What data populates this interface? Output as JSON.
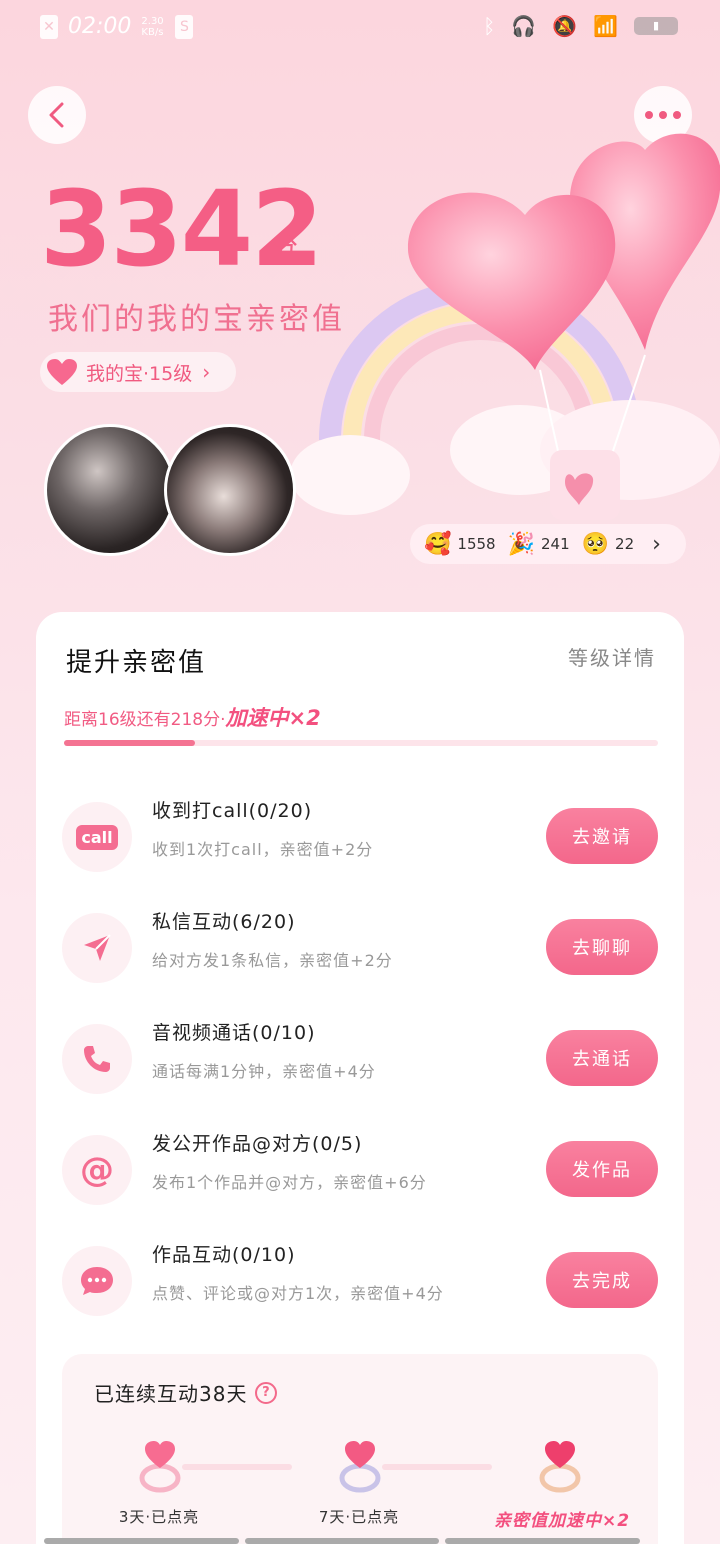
{
  "status_bar": {
    "time": "02:00",
    "speed_value": "2.30",
    "speed_unit": "KB/s"
  },
  "hero": {
    "score": "3342",
    "score_unit": "分",
    "subtitle": "我们的我的宝亲密值",
    "level_label": "我的宝·15级",
    "stats": [
      {
        "emoji": "🥰",
        "value": "1558"
      },
      {
        "emoji": "🎉",
        "value": "241"
      },
      {
        "emoji": "🥺",
        "value": "22"
      }
    ]
  },
  "card": {
    "title": "提升亲密值",
    "detail_link": "等级详情",
    "progress_text": "距离16级还有218分·",
    "boost_text": "加速中×2",
    "progress_fraction": 0.22,
    "tasks": [
      {
        "title": "收到打call(0/20)",
        "desc": "收到1次打call，亲密值+2分",
        "button": "去邀请",
        "icon": "call-icon"
      },
      {
        "title": "私信互动(6/20)",
        "desc": "给对方发1条私信，亲密值+2分",
        "button": "去聊聊",
        "icon": "send-icon"
      },
      {
        "title": "音视频通话(0/10)",
        "desc": "通话每满1分钟，亲密值+4分",
        "button": "去通话",
        "icon": "phone-icon"
      },
      {
        "title": "发公开作品@对方(0/5)",
        "desc": "发布1个作品并@对方，亲密值+6分",
        "button": "发作品",
        "icon": "at-icon"
      },
      {
        "title": "作品互动(0/10)",
        "desc": "点赞、评论或@对方1次，亲密值+4分",
        "button": "去完成",
        "icon": "chat-bubble-icon"
      }
    ],
    "call_icon_text": "call",
    "streak": {
      "title": "已连续互动38天",
      "help": "?",
      "milestones": [
        {
          "label": "3天·已点亮"
        },
        {
          "label": "7天·已点亮"
        },
        {
          "label": "亲密值加速中×2"
        }
      ]
    }
  },
  "colors": {
    "accent": "#f45e85",
    "button": "#f3678b",
    "background": "#fcd6de"
  }
}
